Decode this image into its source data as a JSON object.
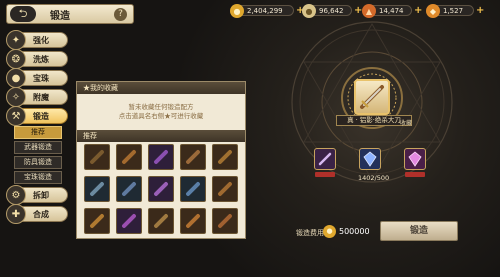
{
  "header": {
    "title": "锻造",
    "back_icon": "back-arrow-icon",
    "help_label": "?"
  },
  "currencies": [
    {
      "value": "2,404,299",
      "icon": "gold-coin-icon",
      "color": "#e0a82e"
    },
    {
      "value": "96,642",
      "icon": "silver-coin-icon",
      "color": "#d9c48a"
    },
    {
      "value": "14,474",
      "icon": "ore-icon",
      "color": "#d46a2a"
    },
    {
      "value": "1,527",
      "icon": "crystal-icon",
      "color": "#e08a2a"
    }
  ],
  "sidebar": {
    "items": [
      {
        "label": "强化",
        "icon": "enhance-icon"
      },
      {
        "label": "洗炼",
        "icon": "refine-icon"
      },
      {
        "label": "宝珠",
        "icon": "orb-icon"
      },
      {
        "label": "附魔",
        "icon": "enchant-icon"
      },
      {
        "label": "锻造",
        "icon": "forge-icon",
        "active": true
      },
      {
        "label": "拆卸",
        "icon": "dismantle-icon"
      },
      {
        "label": "合成",
        "icon": "synthesis-icon"
      }
    ],
    "sub_items": [
      {
        "label": "推荐",
        "active": true
      },
      {
        "label": "武器锻造"
      },
      {
        "label": "防具锻造"
      },
      {
        "label": "宝珠锻造"
      }
    ]
  },
  "panel": {
    "favorites_header": "★我的收藏",
    "favorites_empty_line1": "暂未收藏任何锻造配方",
    "favorites_empty_line2": "点击道具名右侧★可进行收藏",
    "recommend_header": "推荐",
    "items": [
      {
        "icon": "sword-icon",
        "color": "#7a5a2e",
        "bg": "#3b2a1a"
      },
      {
        "icon": "bow-icon",
        "color": "#a36a2e",
        "bg": "#3b2a1a"
      },
      {
        "icon": "staff-icon",
        "color": "#8a4fb0",
        "bg": "#2e1f3a"
      },
      {
        "icon": "staff-icon",
        "color": "#9b6a3a",
        "bg": "#3b2a1a"
      },
      {
        "icon": "axe-icon",
        "color": "#a07030",
        "bg": "#3b2a1a"
      },
      {
        "icon": "spear-icon",
        "color": "#6b8aa0",
        "bg": "#1f2a33"
      },
      {
        "icon": "gun-icon",
        "color": "#5f7aa0",
        "bg": "#1f2a33"
      },
      {
        "icon": "blade-icon",
        "color": "#9a5fb8",
        "bg": "#2e1f3a"
      },
      {
        "icon": "sword-icon",
        "color": "#5a7fa8",
        "bg": "#1f2a33"
      },
      {
        "icon": "gauntlet-icon",
        "color": "#a06a30",
        "bg": "#3b2a1a"
      },
      {
        "icon": "sword-icon",
        "color": "#b07a30",
        "bg": "#3b2a1a"
      },
      {
        "icon": "sword-icon",
        "color": "#9a4fb0",
        "bg": "#2e1f3a"
      },
      {
        "icon": "staff-icon",
        "color": "#a07a40",
        "bg": "#3b2a1a"
      },
      {
        "icon": "bow-icon",
        "color": "#b07030",
        "bg": "#3b2a1a"
      },
      {
        "icon": "axe-icon",
        "color": "#a06030",
        "bg": "#3b2a1a"
      }
    ]
  },
  "forge": {
    "selected_item_name": "真 · 铝影·绝杀大刀",
    "selected_item_icon": "great-sword-icon",
    "favorite_label": "收藏",
    "materials": [
      {
        "icon": "sword-material-icon",
        "count": "",
        "color": "#9a4fb0",
        "tag": true
      },
      {
        "icon": "crystal-material-icon",
        "count": "1402/500",
        "color": "#4a6fb8",
        "tag": false
      },
      {
        "icon": "gem-material-icon",
        "count": "",
        "color": "#c84fb0",
        "tag": true
      }
    ],
    "cost_label": "锻造费用",
    "cost_icon": "gold-coin-icon",
    "cost_value": "500000",
    "forge_button": "锻造"
  }
}
